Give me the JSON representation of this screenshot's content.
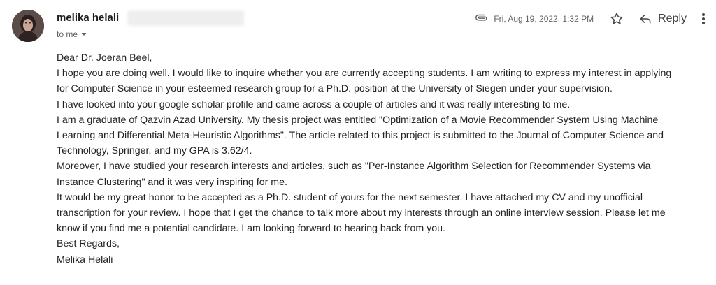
{
  "sender": {
    "name": "melika helali",
    "avatar_icon": "profile-photo"
  },
  "recipient": {
    "label": "to me",
    "chevron_icon": "chevron-down-icon"
  },
  "meta": {
    "attachment_icon": "paperclip-icon",
    "date": "Fri, Aug 19, 2022, 1:32 PM",
    "star_icon": "star-outline-icon",
    "reply_label": "Reply",
    "reply_icon": "reply-arrow-icon",
    "more_icon": "more-vert-icon"
  },
  "body": {
    "lines": [
      "Dear Dr. Joeran Beel,",
      "I hope you are doing well. I would like to inquire whether you are currently accepting students. I am writing to express my interest in applying",
      "for Computer Science in your esteemed research group for a Ph.D. position at the University of Siegen under your supervision.",
      "I have looked into your google scholar profile and came across a couple of articles and it was really interesting to me.",
      "I am a graduate of Qazvin Azad University. My thesis project was entitled \"Optimization of a Movie Recommender System Using Machine",
      "Learning and Differential Meta-Heuristic Algorithms\". The article related to this project is submitted to the Journal of Computer Science and",
      "Technology, Springer, and my GPA is 3.62/4.",
      "Moreover, I have studied your research interests and articles, such as \"Per-Instance Algorithm Selection for Recommender Systems via",
      "Instance Clustering\" and it was very inspiring for me.",
      "It would be my great honor to be accepted as a Ph.D. student of yours for the next semester. I have attached my CV and my unofficial",
      "transcription for your review. I hope that I get the chance to talk more about my interests through an online interview session. Please let me",
      "know if you find me a potential candidate. I am looking forward to hearing back from you.",
      "Best Regards,",
      "Melika Helali"
    ]
  }
}
